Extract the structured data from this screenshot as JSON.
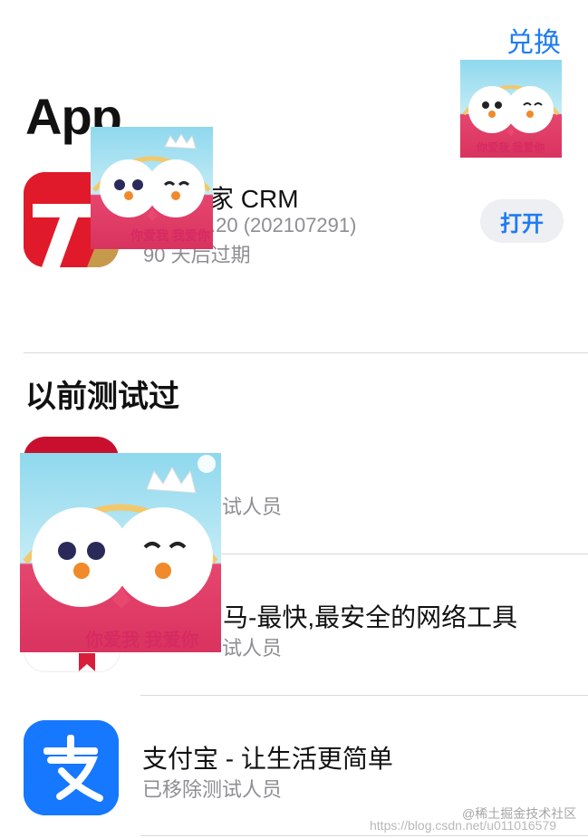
{
  "header": {
    "redeem_label": "兑换"
  },
  "apps_section": {
    "title": "App",
    "app": {
      "name": "CRM",
      "name_partial": "家 CRM",
      "version": ".20 (202107291)",
      "expiry": "90 天后过期",
      "open_label": "打开"
    }
  },
  "previous_section": {
    "title": "以前测试过",
    "items": [
      {
        "name": "",
        "status": "试人员"
      },
      {
        "name": "马-最快,最安全的网络工具",
        "status": "试人员"
      },
      {
        "name": "支付宝 - 让生活更简单",
        "status": "已移除测试人员"
      }
    ]
  },
  "stickers": {
    "caption": "你爱我 我爱你"
  },
  "watermark": {
    "text": "@稀土掘金技术社区",
    "url": "https://blog.csdn.net/u011016579"
  },
  "colors": {
    "accent": "#1e7cf2",
    "alipay": "#1677ff",
    "crm_red": "#e01a2a"
  }
}
